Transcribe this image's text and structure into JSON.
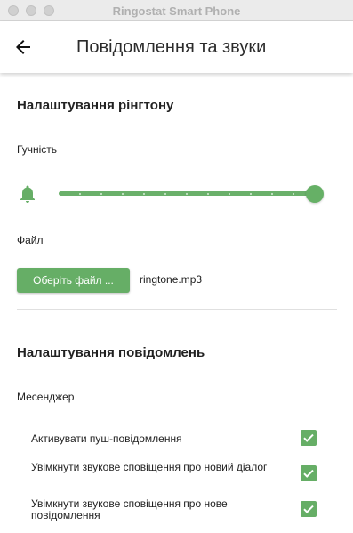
{
  "window": {
    "title": "Ringostat Smart Phone"
  },
  "header": {
    "title": "Повідомлення та звуки",
    "back_icon": "arrow-left-icon"
  },
  "colors": {
    "accent": "#66ae66",
    "accent_light": "#6ab06a"
  },
  "ringtone": {
    "section_title": "Налаштування рінгтону",
    "volume_label": "Гучність",
    "volume_level": 1.0,
    "volume_steps": 12,
    "file_label": "Файл",
    "file_button": "Оберіть файл ...",
    "file_name": "ringtone.mp3"
  },
  "notifications": {
    "section_title": "Налаштування повідомлень",
    "messenger_label": "Месенджер",
    "options": [
      {
        "label": "Активувати пуш-повідомлення",
        "checked": true
      },
      {
        "label": "Увімкнути звукове сповіщення про новий діалог",
        "checked": true
      },
      {
        "label": "Увімкнути звукове сповіщення про нове повідомлення",
        "checked": true
      }
    ]
  }
}
